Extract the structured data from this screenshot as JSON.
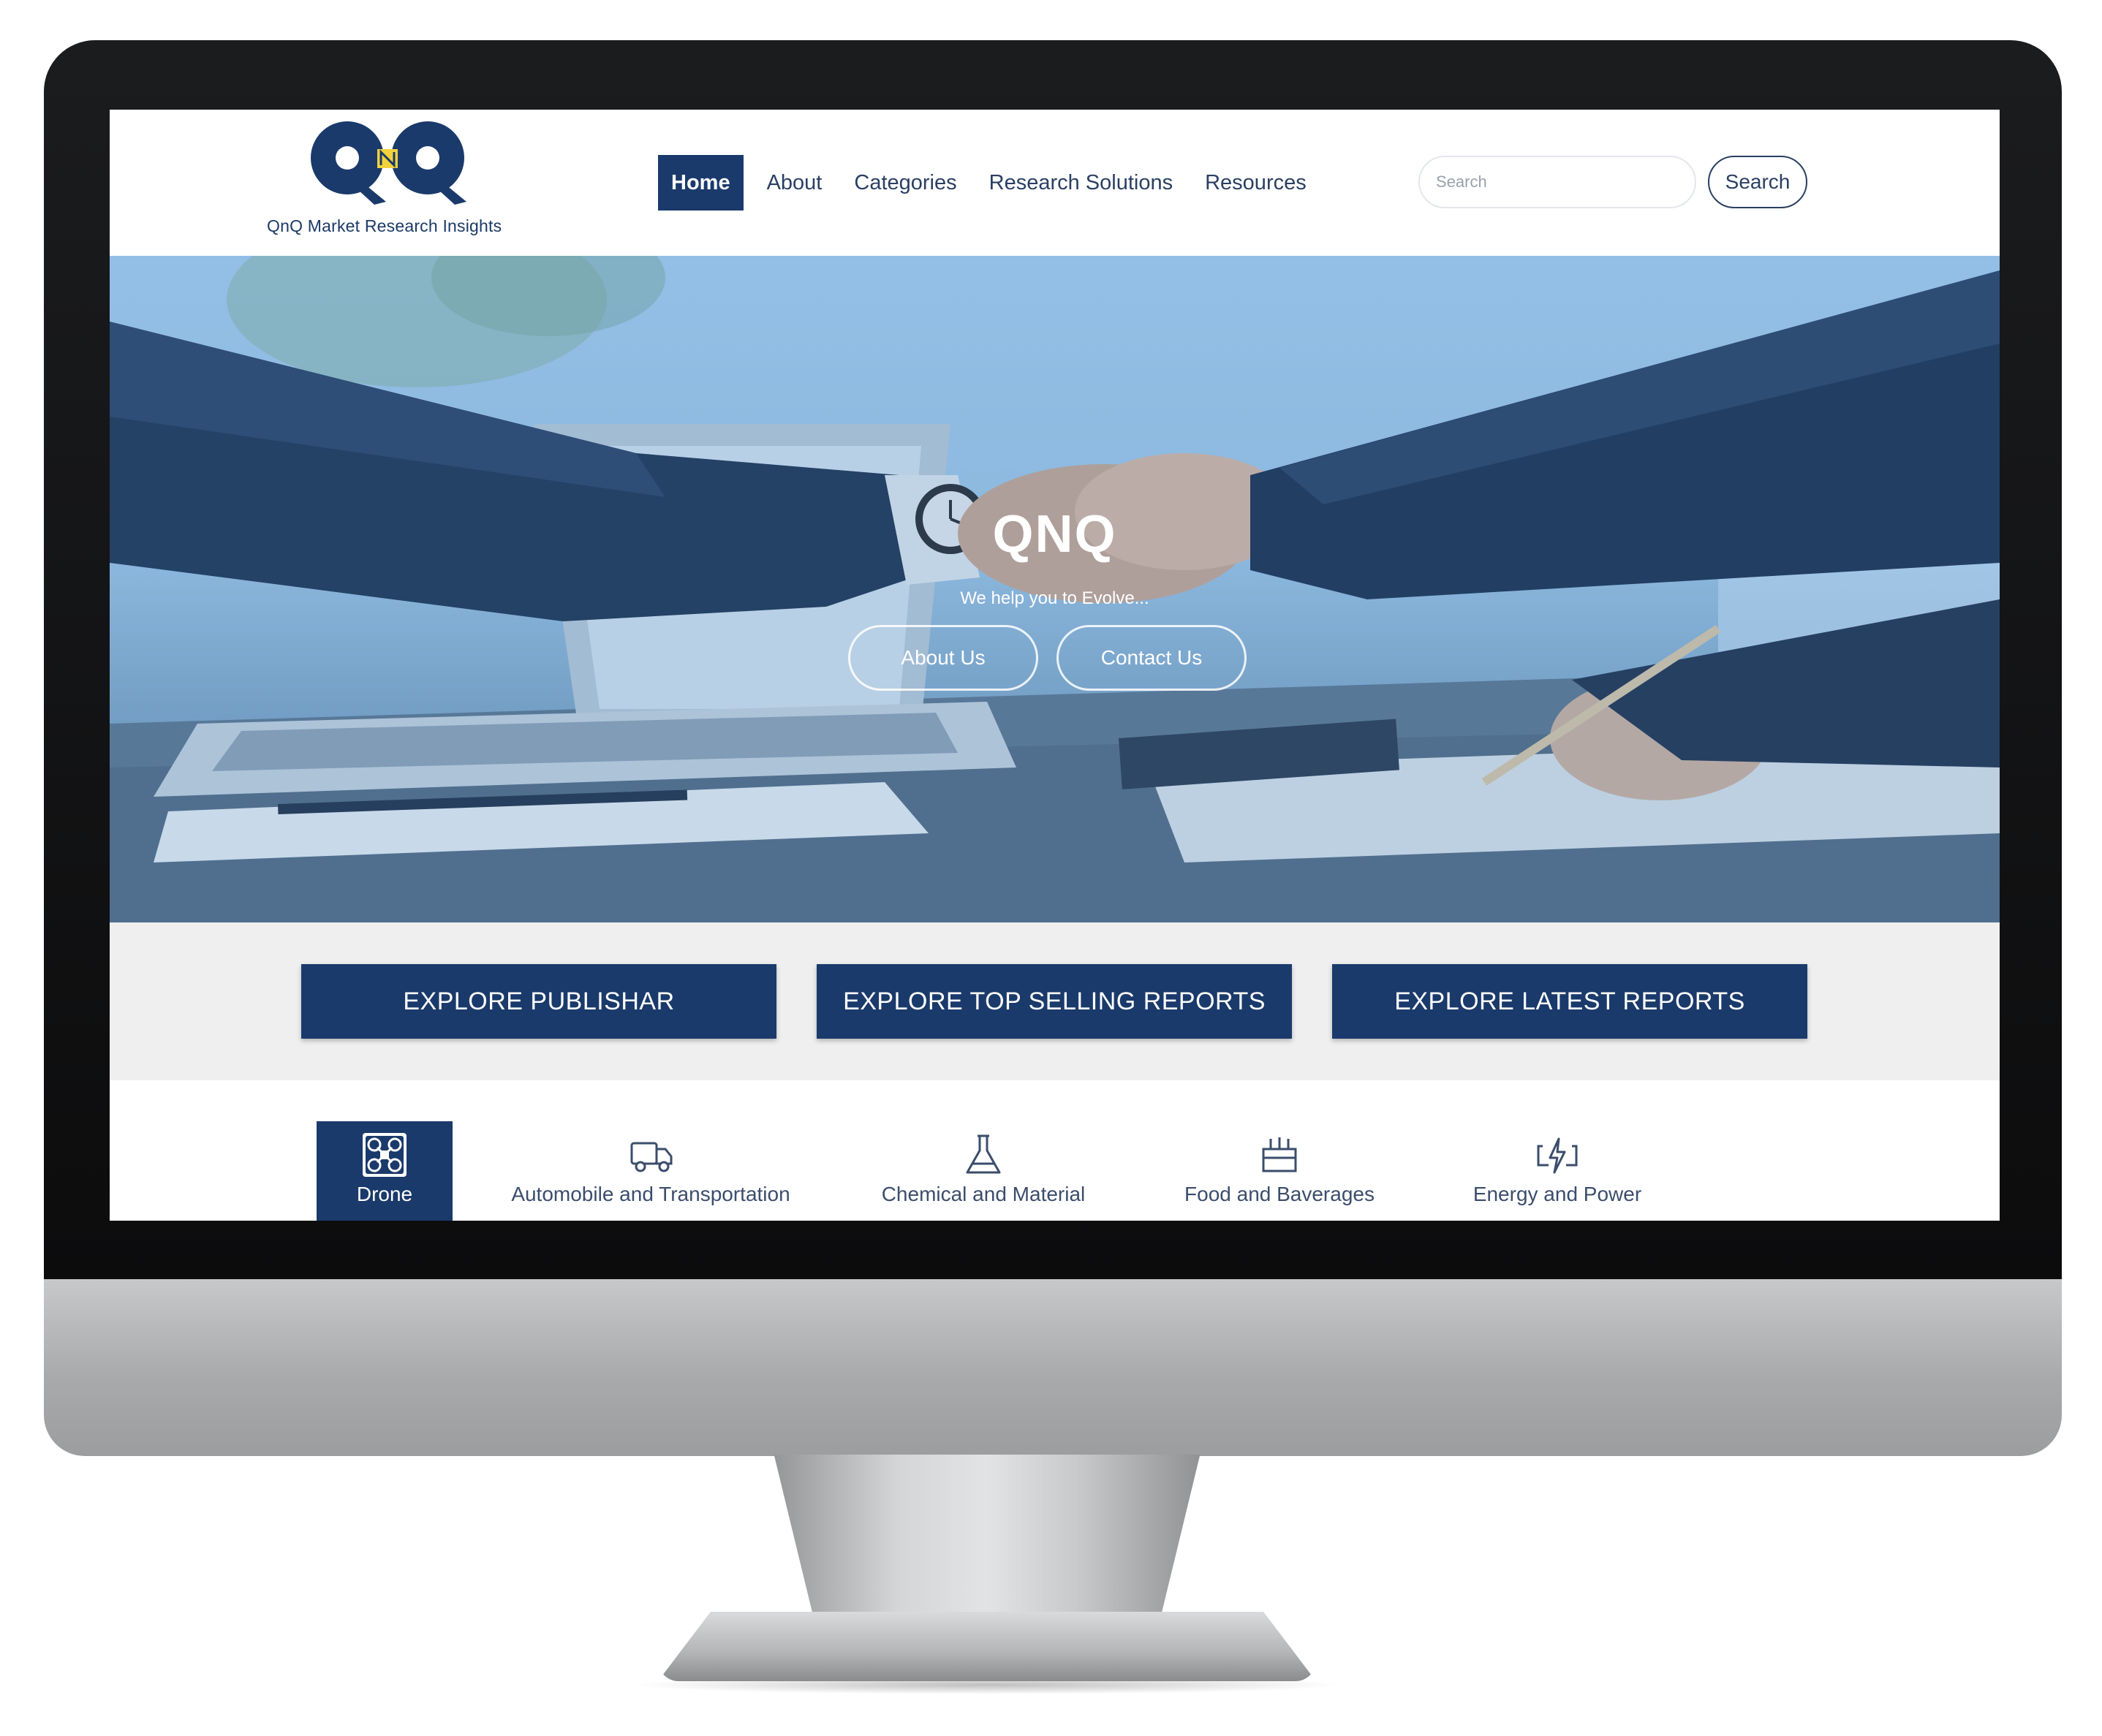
{
  "brand": {
    "logo_letters": "QnQ",
    "logo_text": "QnQ Market Research Insights",
    "primary": "#1a3a6b",
    "accent": "#f2d23c"
  },
  "nav": {
    "items": [
      {
        "label": "Home",
        "active": true
      },
      {
        "label": "About"
      },
      {
        "label": "Categories"
      },
      {
        "label": "Research Solutions"
      },
      {
        "label": "Resources"
      }
    ]
  },
  "search": {
    "placeholder": "Search",
    "button_label": "Search"
  },
  "hero": {
    "title": "QNQ",
    "subtitle": "We help you to Evolve...",
    "buttons": [
      {
        "label": "About Us"
      },
      {
        "label": "Contact Us"
      }
    ]
  },
  "explore": {
    "buttons": [
      {
        "label": "EXPLORE PUBLISHAR"
      },
      {
        "label": "EXPLORE TOP SELLING REPORTS"
      },
      {
        "label": "EXPLORE LATEST REPORTS"
      }
    ]
  },
  "categories": {
    "items": [
      {
        "label": "Drone",
        "icon": "drone-icon",
        "active": true
      },
      {
        "label": "Automobile and Transportation",
        "icon": "truck-icon"
      },
      {
        "label": "Chemical and Material",
        "icon": "flask-icon"
      },
      {
        "label": "Food and Baverages",
        "icon": "food-icon"
      },
      {
        "label": "Energy and Power",
        "icon": "energy-icon"
      }
    ]
  }
}
